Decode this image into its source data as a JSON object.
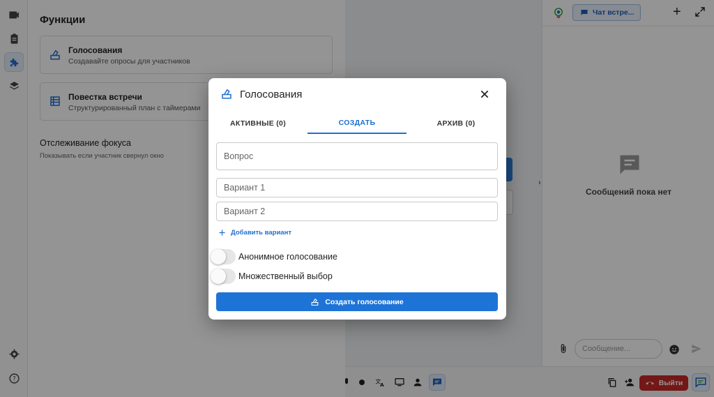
{
  "colors": {
    "accent": "#1e74d6",
    "danger": "#c62828",
    "overlay": "rgba(0,0,0,0.42)"
  },
  "rail": {
    "items": [
      {
        "icon": "video-icon"
      },
      {
        "icon": "clipboard-icon"
      },
      {
        "icon": "puzzle-icon",
        "active": true
      },
      {
        "icon": "layers-icon"
      }
    ],
    "bottom": [
      {
        "icon": "gear-icon"
      },
      {
        "icon": "help-icon"
      }
    ]
  },
  "functions": {
    "title": "Функции",
    "cards": [
      {
        "title": "Голосования",
        "subtitle": "Создавайте опросы для участников",
        "icon": "ballot-icon"
      },
      {
        "title": "Повестка встречи",
        "subtitle": "Структурированный план с таймерами",
        "icon": "table-icon"
      }
    ],
    "focus": {
      "title": "Отслеживание фокуса",
      "subtitle": "Показывать если участник свернул окно"
    }
  },
  "chat": {
    "tab_label": "Чат встре...",
    "empty_text": "Сообщений пока нет",
    "input_placeholder": "Сообщение..."
  },
  "bottombar": {
    "leave_label": "Выйти"
  },
  "modal": {
    "title": "Голосования",
    "tabs": [
      {
        "label": "АКТИВНЫЕ (0)"
      },
      {
        "label": "СОЗДАТЬ",
        "active": true
      },
      {
        "label": "АРХИВ (0)"
      }
    ],
    "question_placeholder": "Вопрос",
    "options": [
      {
        "placeholder": "Вариант 1"
      },
      {
        "placeholder": "Вариант 2"
      }
    ],
    "add_option_label": "Добавить вариант",
    "toggles": [
      {
        "label": "Анонимное голосование",
        "on": false
      },
      {
        "label": "Множественный выбор",
        "on": false
      }
    ],
    "submit_label": "Создать голосование"
  }
}
